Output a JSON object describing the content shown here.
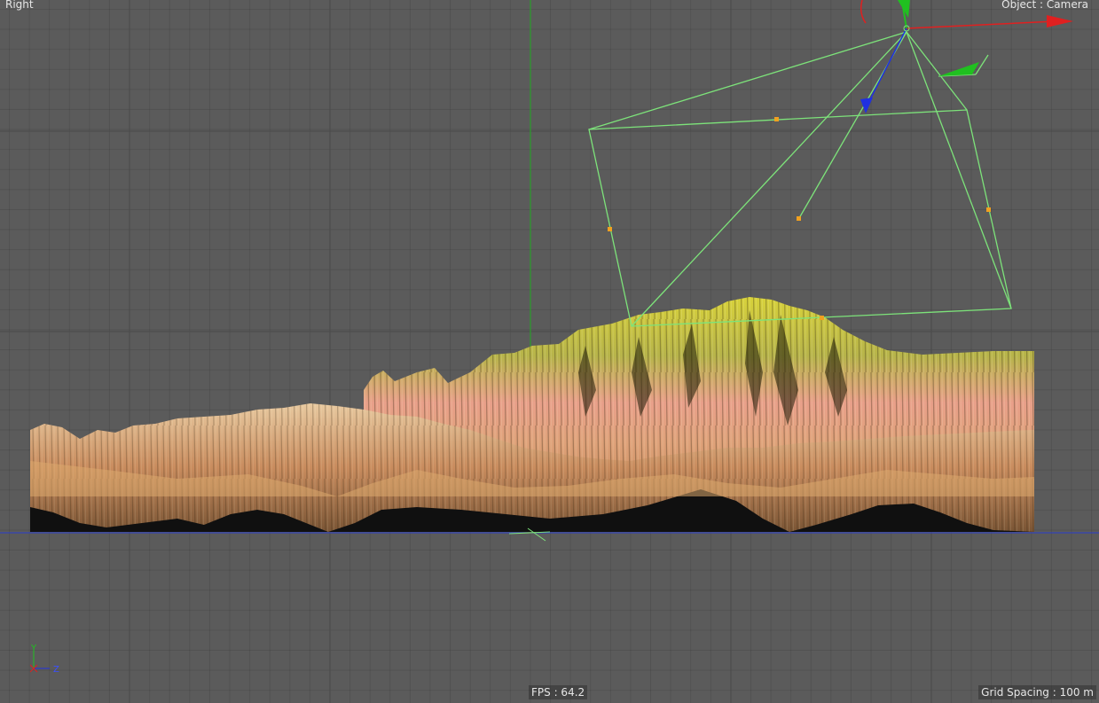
{
  "viewport": {
    "view_name": "Right",
    "object_label": "Object : Camera",
    "fps": "FPS : 64.2",
    "grid_spacing": "Grid Spacing : 100 m"
  },
  "axis_gizmo": {
    "y_label": "Y",
    "z_label": "Z"
  },
  "colors": {
    "background": "#5b5b5b",
    "camera_frustum": "#7de37a",
    "handle": "#f0a020",
    "axis_x": "#e02020",
    "axis_y": "#20c020",
    "axis_z": "#2030e0",
    "vertical_axis": "#22aa22",
    "ground_line": "#2a3ccc"
  },
  "icons": [
    "camera-object-icon",
    "viewport-axis-icon"
  ]
}
